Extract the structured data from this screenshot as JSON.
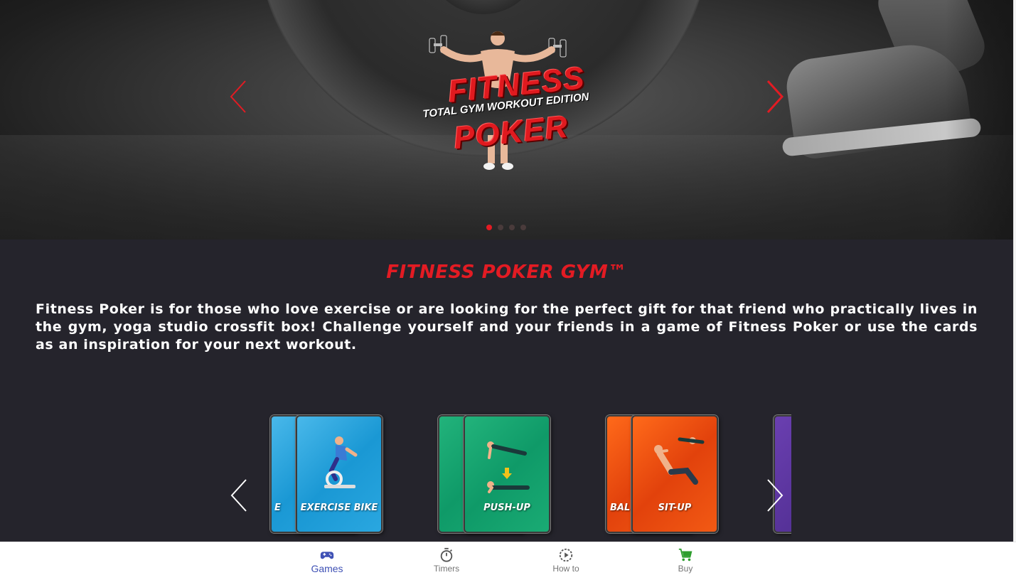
{
  "hero": {
    "logo_word_1": "FITNESS",
    "logo_subtitle": "TOTAL GYM WORKOUT EDITION",
    "logo_word_2": "POKER",
    "slide_count": 4,
    "active_slide": 1
  },
  "section": {
    "title": "FITNESS POKER GYM™",
    "description": "Fitness Poker is for those who love exercise or are looking for the perfect gift for that friend who practically lives in the gym, yoga studio crossfit box! Challenge yourself and your friends in a game of Fitness Poker or use the cards as an inspiration for your next workout."
  },
  "cards": [
    {
      "front_label": "EXERCISE BIKE",
      "back_label": "E",
      "color": "blue"
    },
    {
      "front_label": "PUSH-UP",
      "back_label": "",
      "color": "green"
    },
    {
      "front_label": "SIT-UP",
      "back_label": "BAL C",
      "color": "orange"
    },
    {
      "front_label": "",
      "back_label": "",
      "color": "purple"
    }
  ],
  "bottom_nav": {
    "items": [
      {
        "label": "Games",
        "icon": "gamepad-icon",
        "active": true
      },
      {
        "label": "Timers",
        "icon": "stopwatch-icon",
        "active": false
      },
      {
        "label": "How to",
        "icon": "play-circle-icon",
        "active": false
      },
      {
        "label": "Buy",
        "icon": "cart-icon",
        "active": false
      }
    ]
  },
  "colors": {
    "accent_red": "#e31b23",
    "background": "#25242c",
    "nav_active": "#3f51b5",
    "buy_icon": "#2e9e2e"
  }
}
